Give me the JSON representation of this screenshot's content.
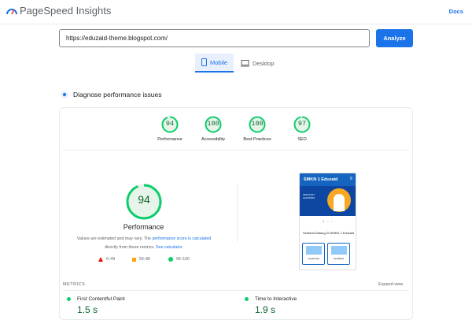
{
  "app": {
    "title": "PageSpeed Insights",
    "docs_label": "Docs"
  },
  "search": {
    "value": "https://eduzaid-theme.blogspot.com/",
    "button_label": "Analyze"
  },
  "tabs": [
    {
      "label": "Mobile",
      "active": true
    },
    {
      "label": "Desktop",
      "active": false
    }
  ],
  "diagnose": {
    "title": "Diagnose performance issues"
  },
  "scores": [
    {
      "label": "Performance",
      "value": "94",
      "level": 0.94
    },
    {
      "label": "Accessibility",
      "value": "100",
      "level": 1.0
    },
    {
      "label": "Best Practices",
      "value": "100",
      "level": 1.0
    },
    {
      "label": "SEO",
      "value": "97",
      "level": 0.97
    }
  ],
  "performance": {
    "value": "94",
    "level": 0.94,
    "title": "Performance",
    "note_prefix": "Values are estimated and may vary. The",
    "note_link": "performance score is calculated",
    "note_mid": "directly from these metrics.",
    "note_link2": "See calculator."
  },
  "legend": [
    {
      "range": "0–49",
      "color": "#eb0f00"
    },
    {
      "range": "50–89",
      "color": "#ffa400"
    },
    {
      "range": "90–100",
      "color": "#0cce6b"
    }
  ],
  "preview": {
    "site_title": "SMKN 1 Eduzaid",
    "menu_icon": "menu-icon",
    "hero_text": "INDUSTRY LEARNING",
    "heading": "Selamat Datang Di SMKN 1 Eduzaid",
    "cards": [
      "Leadership",
      "Sertifikasi"
    ]
  },
  "metrics": {
    "label": "METRICS",
    "expand_label": "Expand view",
    "items": [
      {
        "name": "First Contentful Paint",
        "value": "1.5 s"
      },
      {
        "name": "Time to Interactive",
        "value": "1.9 s"
      }
    ]
  },
  "colors": {
    "accent": "#1a73e8",
    "pass": "#0cce6b",
    "pass_text": "#0d652d"
  }
}
